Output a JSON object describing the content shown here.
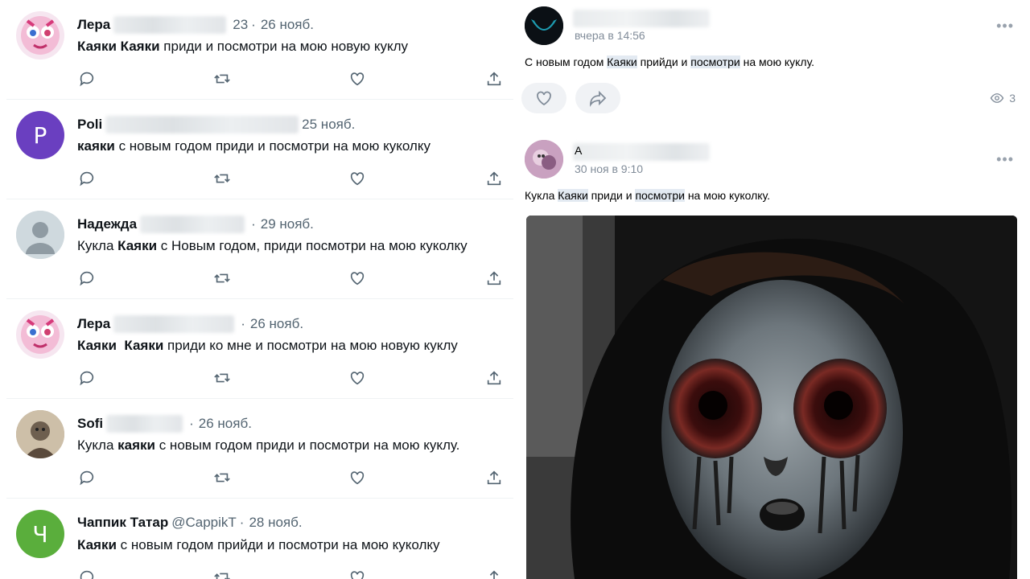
{
  "left_feed": {
    "tweets": [
      {
        "name": "Лера",
        "handle_tail": "23",
        "date": "26 нояб.",
        "text_bold": "Каяки Каяки",
        "text_rest": " приди и посмотри на мою новую куклу"
      },
      {
        "name": "Poli",
        "handle_tail": "",
        "date": "25 нояб.",
        "text_bold": "каяки",
        "text_rest": " с новым годом приди и посмотри на мою куколку",
        "avatar_letter": "P"
      },
      {
        "name": "Надежда",
        "handle_tail": "",
        "date": "29 нояб.",
        "text_pre": "Кукла ",
        "text_bold": "Каяки",
        "text_rest": " с Новым годом,  приди посмотри на мою куколку"
      },
      {
        "name": "Лера",
        "handle_tail": "",
        "date": "26 нояб.",
        "text_bold": "Каяки  Каяки",
        "text_rest": " приди ко мне и посмотри на мою новую куклу"
      },
      {
        "name": "Sofi",
        "handle_tail": "",
        "date": "26 нояб.",
        "text_pre": "Кукла ",
        "text_bold": "каяки",
        "text_rest": " с новым годом приди и посмотри на мою куклу."
      },
      {
        "name": "Чаппик Татар",
        "handle": "@CappikT",
        "date": "28 нояб.",
        "text_bold": "Каяки",
        "text_rest": " с новым годом прийди и посмотри на мою куколку",
        "avatar_letter": "Ч"
      }
    ],
    "dot": "·",
    "icons": [
      "reply-icon",
      "retweet-icon",
      "like-icon",
      "share-icon"
    ]
  },
  "right_feed": {
    "post1": {
      "time": "вчера в 14:56",
      "more": "•••",
      "text_a": "С новым годом ",
      "text_hl1": "Каяки",
      "text_b": " прийди и ",
      "text_hl2": "посмотри",
      "text_c": " на мою куклу.",
      "views": "3"
    },
    "post2": {
      "name_initial": "А",
      "time": "30 ноя в 9:10",
      "more": "•••",
      "text_a": "Кукла ",
      "text_hl1": "Каяки",
      "text_b": " приди и ",
      "text_hl2": "посмотри",
      "text_c": " на мою куколку."
    }
  },
  "colors": {
    "poli_avatar": "#6a3fc0",
    "chappik_avatar": "#5aae3c",
    "secondary_text": "#536471",
    "vk_secondary": "#818c99",
    "vk_highlight": "#e3eaf2"
  }
}
